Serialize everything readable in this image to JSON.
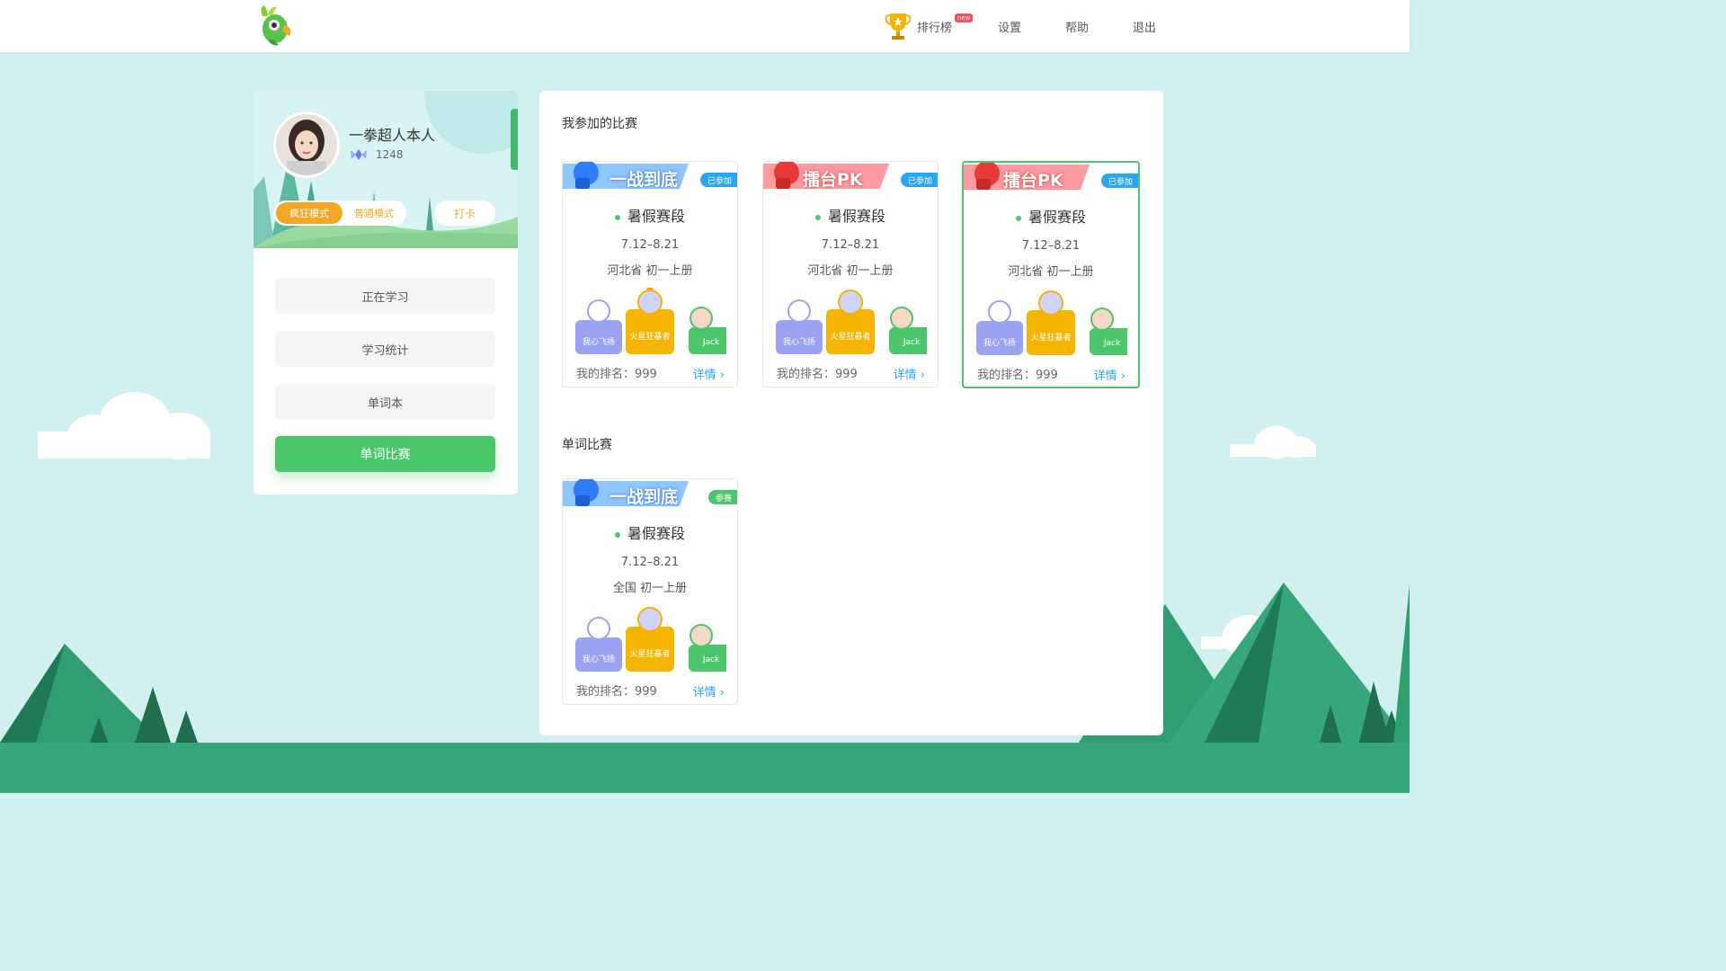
{
  "header": {
    "nav": {
      "rank": "排行榜",
      "rank_badge": "new",
      "settings": "设置",
      "help": "帮助",
      "exit": "退出"
    }
  },
  "profile": {
    "username": "一拳超人本人",
    "score": "1248",
    "mode_crazy": "疯狂模式",
    "mode_normal": "普通模式",
    "checkin": "打卡",
    "menu": [
      "正在学习",
      "学习统计",
      "单词本",
      "单词比赛"
    ]
  },
  "main": {
    "joined_title": "我参加的比赛",
    "word_contest_title": "单词比赛",
    "joined_contests": [
      {
        "banner": "一战到底",
        "status": "已参加",
        "name": "暑假赛段",
        "date": "7.12–8.21",
        "region": "河北省  初一上册",
        "rank": "我的排名：999",
        "detail": "详情 ›",
        "podium": [
          "我心飞扬",
          "火星狂暴者",
          "Jack"
        ]
      },
      {
        "banner": "擂台PK",
        "status": "已参加",
        "name": "暑假赛段",
        "date": "7.12–8.21",
        "region": "河北省  初一上册",
        "rank": "我的排名：999",
        "detail": "详情 ›",
        "podium": [
          "我心飞扬",
          "火星狂暴者",
          "Jack"
        ]
      },
      {
        "banner": "擂台PK",
        "status": "已参加",
        "name": "暑假赛段",
        "date": "7.12–8.21",
        "region": "河北省  初一上册",
        "rank": "我的排名：999",
        "detail": "详情 ›",
        "podium": [
          "我心飞扬",
          "火星狂暴者",
          "Jack"
        ]
      }
    ],
    "word_contests": [
      {
        "banner": "一战到底",
        "status": "参赛",
        "name": "暑假赛段",
        "date": "7.12–8.21",
        "region": "全国  初一上册",
        "rank": "我的排名：999",
        "detail": "详情 ›",
        "podium": [
          "我心飞扬",
          "火星狂暴者",
          "Jack"
        ]
      }
    ]
  },
  "colors": {
    "accent_green": "#4cc66a",
    "accent_orange": "#f5a623",
    "accent_blue": "#2aa6ef",
    "background": "#d3f0f0",
    "ground": "#35a77a"
  }
}
